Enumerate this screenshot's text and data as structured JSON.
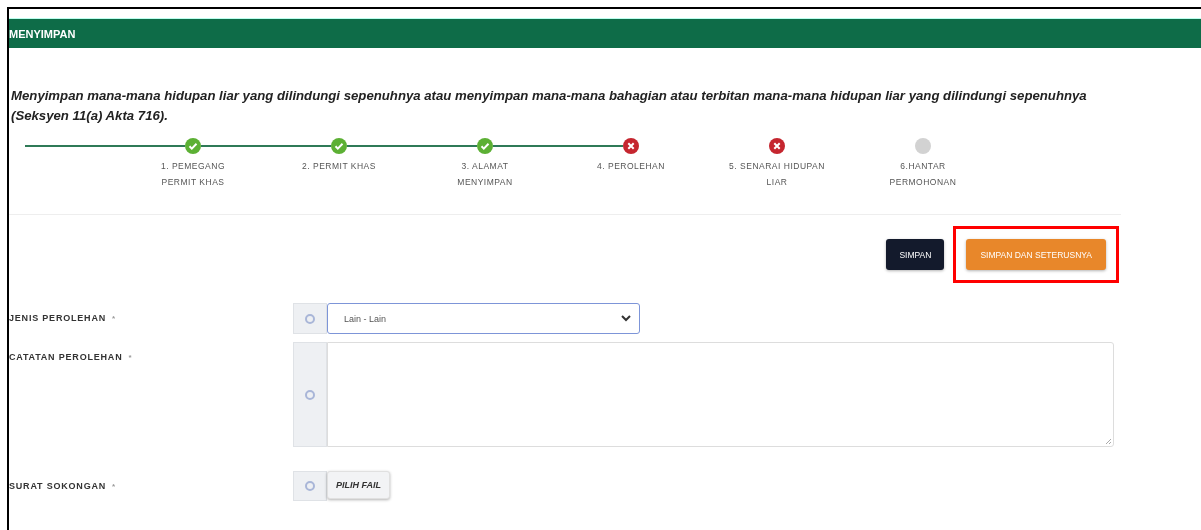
{
  "header": {
    "title": "MENYIMPAN"
  },
  "description": "Menyimpan mana-mana hidupan liar yang dilindungi sepenuhnya atau menyimpan mana-mana bahagian atau terbitan mana-mana hidupan liar yang dilindungi sepenuhnya (Seksyen 11(a) Akta 716).",
  "steps": [
    {
      "label": "1. PEMEGANG PERMIT KHAS",
      "kind": "done"
    },
    {
      "label": "2. PERMIT KHAS",
      "kind": "done"
    },
    {
      "label": "3. ALAMAT MENYIMPAN",
      "kind": "done"
    },
    {
      "label": "4. PEROLEHAN",
      "kind": "error"
    },
    {
      "label": "5. SENARAI HIDUPAN LIAR",
      "kind": "error"
    },
    {
      "label": "6.HANTAR PERMOHONAN",
      "kind": "pending"
    }
  ],
  "buttons": [
    {
      "label": "SIMPAN",
      "kind": "dark",
      "highlighted": false
    },
    {
      "label": "SIMPAN DAN SETERUSNYA",
      "kind": "orange",
      "highlighted": true
    }
  ],
  "fields": [
    {
      "label": "JENIS PEROLEHAN",
      "required_mark": "*",
      "kind": "select",
      "value": "Lain - Lain"
    },
    {
      "label": "CATATAN PEROLEHAN",
      "required_mark": "*",
      "kind": "textarea"
    },
    {
      "label": "SURAT SOKONGAN",
      "required_mark": "*",
      "kind": "file",
      "button": "PILIH FAIL"
    }
  ]
}
